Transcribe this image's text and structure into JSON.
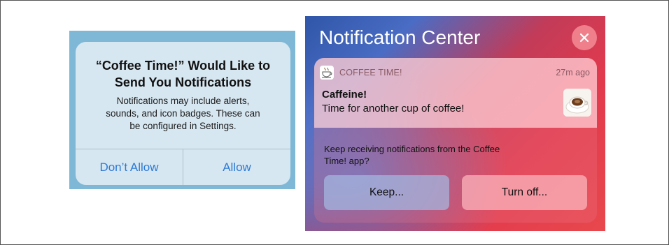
{
  "permission_alert": {
    "title_line1": "“Coffee Time!” Would Like to",
    "title_line2": "Send You Notifications",
    "message_line1": "Notifications may include alerts,",
    "message_line2": "sounds, and icon badges. These can",
    "message_line3": "be configured in Settings.",
    "deny_label": "Don’t Allow",
    "allow_label": "Allow"
  },
  "notification_center": {
    "title": "Notification Center",
    "close_icon": "close-icon",
    "notification": {
      "app_name": "COFFEE TIME!",
      "app_icon": "coffee-cup-icon",
      "time": "27m ago",
      "title": "Caffeine!",
      "body": "Time for another cup of coffee!",
      "thumbnail": "coffee-cup-thumbnail"
    },
    "prompt_line1": "Keep receiving notifications from the Coffee",
    "prompt_line2": "Time! app?",
    "keep_label": "Keep...",
    "turn_off_label": "Turn off..."
  }
}
